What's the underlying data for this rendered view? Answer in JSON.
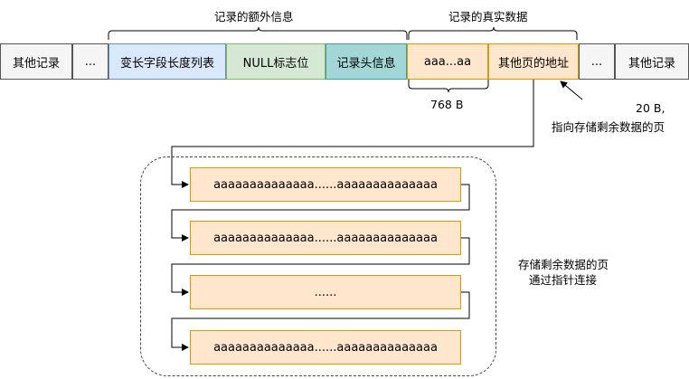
{
  "top_labels": {
    "extra_info": "记录的额外信息",
    "real_data": "记录的真实数据"
  },
  "row": {
    "other_left": "其他记录",
    "ellipsis_left": "...",
    "var_len_list": "变长字段长度列表",
    "null_flags": "NULL标志位",
    "record_header": "记录头信息",
    "data_prefix": "aaa...aa",
    "other_page_addr": "其他页的地址",
    "ellipsis_right": "...",
    "other_right": "其他记录"
  },
  "size_label": "768 B",
  "pointer_note": {
    "line1": "20 B,",
    "line2": "指向存储剩余数据的页"
  },
  "pages": [
    "aaaaaaaaaaaaaa......aaaaaaaaaaaaaa",
    "aaaaaaaaaaaaaa......aaaaaaaaaaaaaa",
    "......",
    "aaaaaaaaaaaaaa......aaaaaaaaaaaaaa"
  ],
  "group_note": {
    "line1": "存储剩余数据的页",
    "line2": "通过指针连接"
  }
}
